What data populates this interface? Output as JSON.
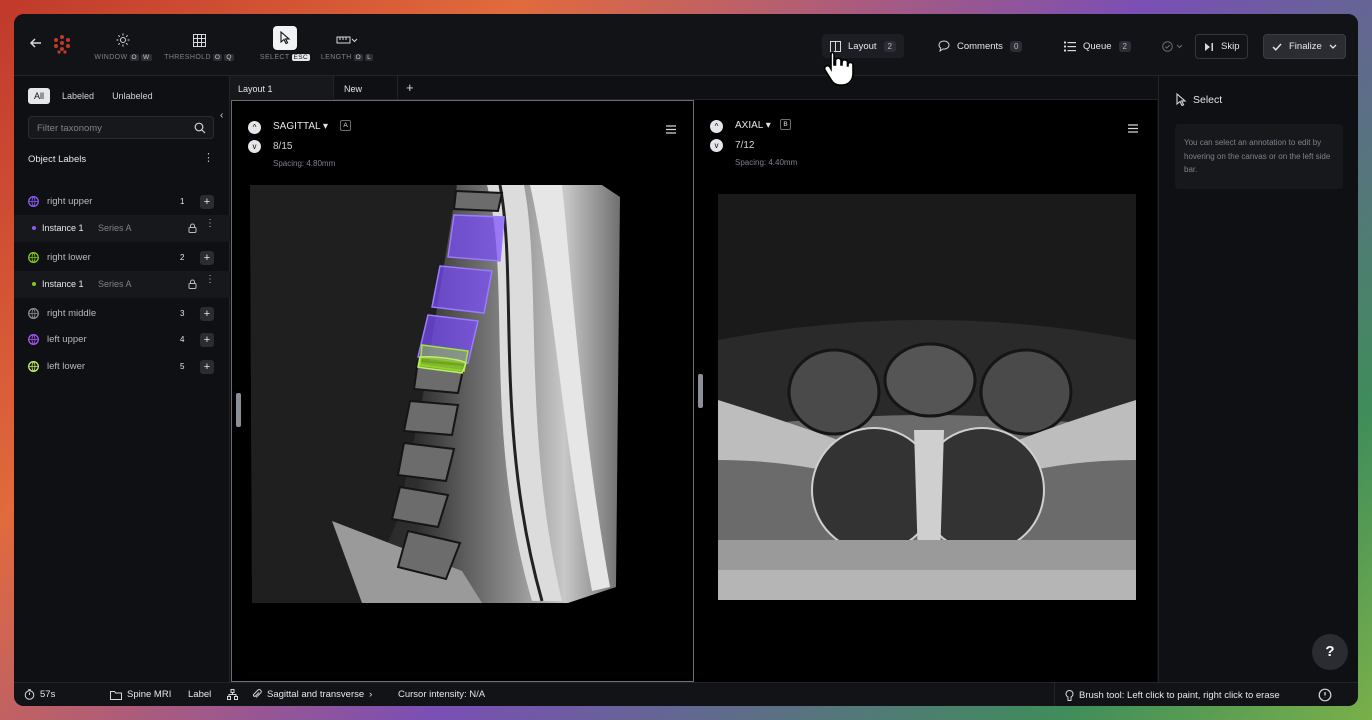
{
  "toolbar": {
    "back_icon": "arrow-left-icon",
    "tools": [
      {
        "icon": "sun-icon",
        "label": "WINDOW",
        "keys": [
          "O",
          "W"
        ]
      },
      {
        "icon": "grid-icon",
        "label": "THRESHOLD",
        "keys": [
          "O",
          "Q"
        ]
      },
      {
        "icon": "pointer-icon",
        "label": "SELECT",
        "keys": [
          "ESC"
        ]
      },
      {
        "icon": "ruler-icon",
        "label": "LENGTH",
        "keys": [
          "O",
          "L"
        ]
      }
    ],
    "layout": {
      "label": "Layout",
      "count": "2"
    },
    "comments": {
      "label": "Comments",
      "count": "0"
    },
    "queue": {
      "label": "Queue",
      "count": "2"
    },
    "skip": "Skip",
    "finalize": "Finalize"
  },
  "sidebar": {
    "filters": [
      "All",
      "Labeled",
      "Unlabeled"
    ],
    "active_filter": "All",
    "search_placeholder": "Filter taxonomy",
    "section_title": "Object Labels",
    "labels": [
      {
        "name": "right upper",
        "num": "1",
        "color": "#8a5cf6"
      },
      {
        "name": "right lower",
        "num": "2",
        "color": "#84cc16"
      },
      {
        "name": "right middle",
        "num": "3",
        "color": "#8b8f97"
      },
      {
        "name": "left upper",
        "num": "4",
        "color": "#a855f7"
      },
      {
        "name": "left lower",
        "num": "5",
        "color": "#bef264"
      }
    ],
    "instances": [
      {
        "name": "Instance 1",
        "series": "Series A",
        "color": "#8a5cf6"
      },
      {
        "name": "Instance 1",
        "series": "Series A",
        "color": "#84cc16"
      }
    ]
  },
  "tabs": {
    "active": "Layout 1",
    "other": "New"
  },
  "viewports": [
    {
      "plane": "SAGITTAL",
      "tag": "A",
      "slice": "8/15",
      "spacing": "Spacing: 4.80mm"
    },
    {
      "plane": "AXIAL",
      "tag": "B",
      "slice": "7/12",
      "spacing": "Spacing: 4.40mm"
    }
  ],
  "right_panel": {
    "title": "Select",
    "note": "You can select an annotation to edit by hovering on the canvas or on the left side bar."
  },
  "status": {
    "timer": "57s",
    "project": "Spine MRI",
    "mode": "Label",
    "series": "Sagittal and transverse",
    "cursor": "Cursor intensity: N/A",
    "hint": "Brush tool: Left click to paint, right click to erase"
  },
  "help_label": "?"
}
